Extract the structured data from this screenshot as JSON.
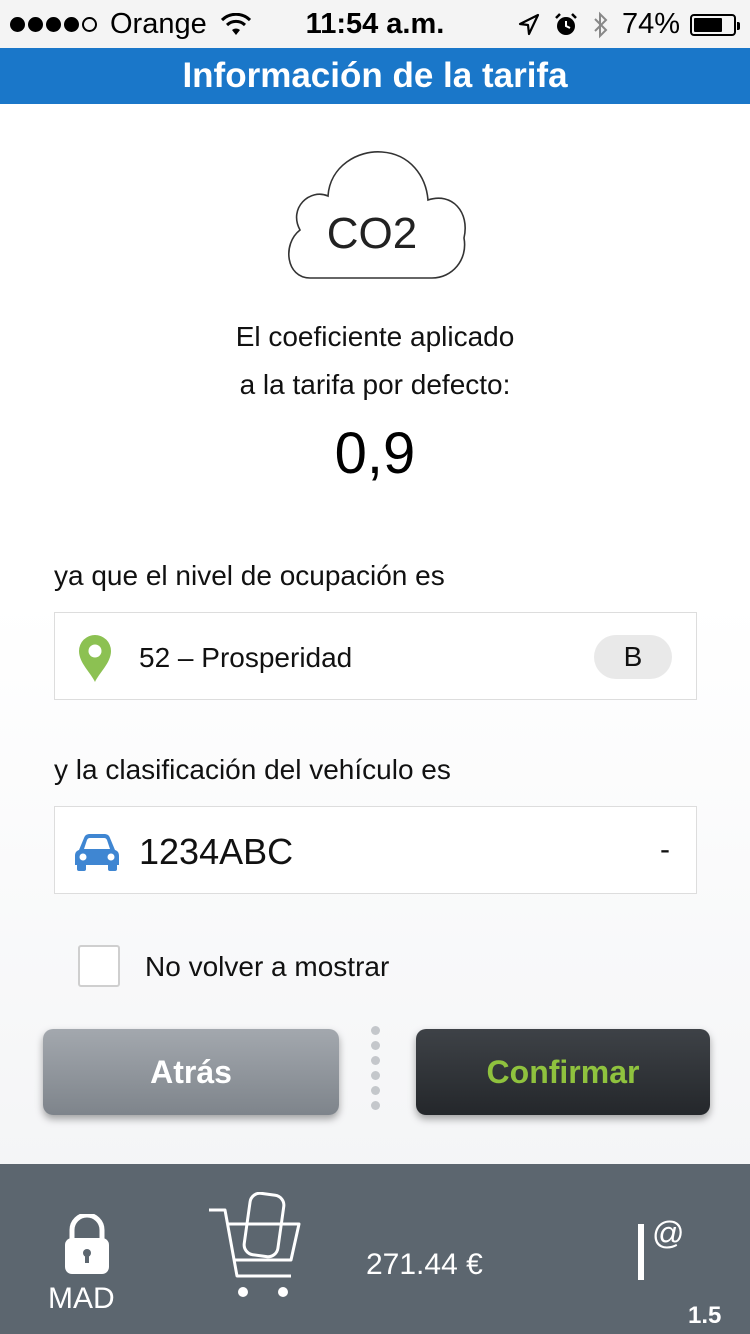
{
  "status_bar": {
    "carrier": "Orange",
    "time": "11:54 a.m.",
    "battery_percent": "74%",
    "battery_level": 0.74,
    "signal_bars_filled": 4,
    "signal_bars_total": 5,
    "icons": [
      "wifi-icon",
      "location-arrow-icon",
      "alarm-icon",
      "bluetooth-icon",
      "battery-icon"
    ]
  },
  "header": {
    "title": "Información de la tarifa"
  },
  "cloud": {
    "label": "CO2"
  },
  "coefficient": {
    "line1": "El coeficiente aplicado",
    "line2": "a la tarifa por defecto:",
    "value": "0,9"
  },
  "occupancy": {
    "label": "ya que el nivel de ocupación es",
    "zone": "52 – Prosperidad",
    "level": "B",
    "icon": "map-pin-icon"
  },
  "vehicle": {
    "label": "y la clasificación del vehículo es",
    "plate": "1234ABC",
    "classification": "-",
    "icon": "car-icon"
  },
  "dont_show": {
    "label": "No volver a mostrar",
    "checked": false
  },
  "buttons": {
    "back": "Atrás",
    "confirm": "Confirmar"
  },
  "bottom_bar": {
    "city": "MAD",
    "balance": "271.44 €",
    "version": "1.5",
    "icons": [
      "lock-icon",
      "cart-icon",
      "at-icon"
    ]
  },
  "colors": {
    "header_blue": "#1a77c9",
    "accent_green": "#8fc23e",
    "car_blue": "#3f86d2",
    "pin_green": "#8cc152",
    "bottom_bar": "#5c666f"
  }
}
